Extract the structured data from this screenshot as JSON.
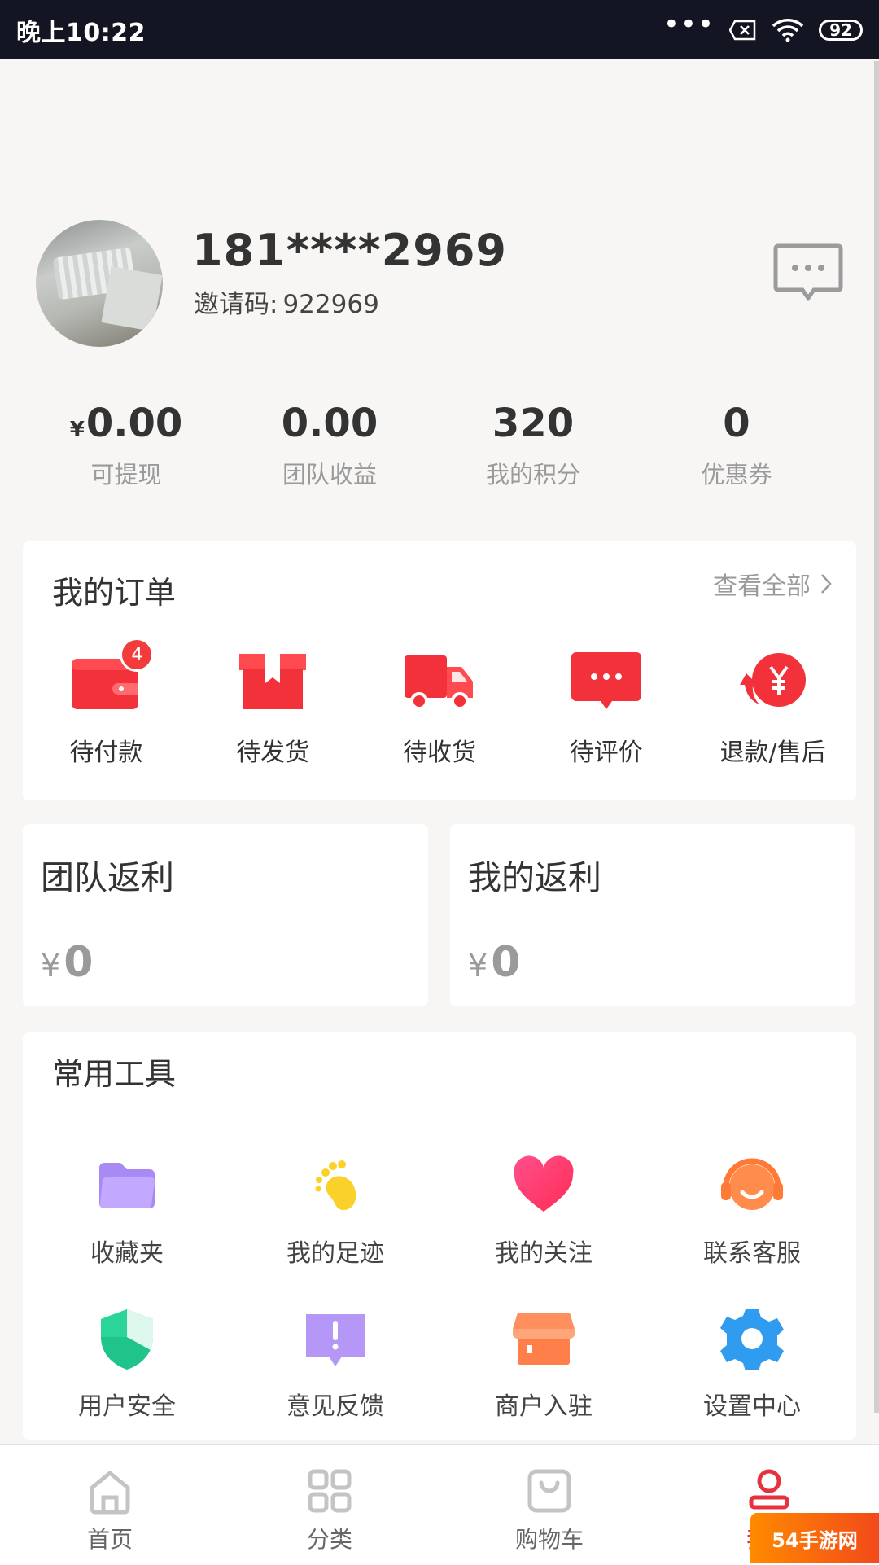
{
  "status_bar": {
    "time": "晚上10:22",
    "more": "•••",
    "battery": "92"
  },
  "profile": {
    "phone": "181****2969",
    "invite_label": "邀请码:",
    "invite_code": "922969"
  },
  "stats": [
    {
      "currency": "¥",
      "value": "0.00",
      "label": "可提现"
    },
    {
      "value": "0.00",
      "label": "团队收益"
    },
    {
      "value": "320",
      "label": "我的积分"
    },
    {
      "value": "0",
      "label": "优惠券"
    }
  ],
  "orders": {
    "title": "我的订单",
    "view_all": "查看全部",
    "items": [
      {
        "label": "待付款",
        "badge": "4",
        "icon": "wallet-icon"
      },
      {
        "label": "待发货",
        "icon": "box-icon"
      },
      {
        "label": "待收货",
        "icon": "truck-icon"
      },
      {
        "label": "待评价",
        "icon": "chat-bubble-icon"
      },
      {
        "label": "退款/售后",
        "icon": "refund-icon"
      }
    ]
  },
  "rebates": {
    "team": {
      "title": "团队返利",
      "currency": "¥",
      "value": "0"
    },
    "mine": {
      "title": "我的返利",
      "currency": "¥",
      "value": "0"
    }
  },
  "tools": {
    "title": "常用工具",
    "items": [
      {
        "label": "收藏夹",
        "icon": "folder-icon"
      },
      {
        "label": "我的足迹",
        "icon": "footprint-icon"
      },
      {
        "label": "我的关注",
        "icon": "heart-icon"
      },
      {
        "label": "联系客服",
        "icon": "headset-icon"
      },
      {
        "label": "用户安全",
        "icon": "shield-icon"
      },
      {
        "label": "意见反馈",
        "icon": "feedback-icon"
      },
      {
        "label": "商户入驻",
        "icon": "store-icon"
      },
      {
        "label": "设置中心",
        "icon": "gear-icon"
      }
    ]
  },
  "nav": [
    {
      "label": "首页",
      "icon": "home-icon"
    },
    {
      "label": "分类",
      "icon": "grid-icon"
    },
    {
      "label": "购物车",
      "icon": "cart-icon"
    },
    {
      "label": "我的",
      "icon": "user-icon",
      "active": true
    }
  ],
  "watermark": "54手游网",
  "colors": {
    "accent": "#e5323e",
    "status_bar": "#141523",
    "background": "#f7f6f5"
  }
}
